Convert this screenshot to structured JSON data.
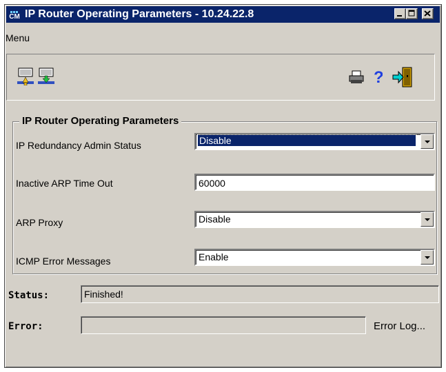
{
  "window": {
    "title": "IP Router Operating Parameters - 10.24.22.8",
    "logo_text": "CM"
  },
  "menu": {
    "label": "Menu"
  },
  "toolbar": {
    "buttons": [
      "upload-icon",
      "download-icon",
      "print-icon",
      "help-icon",
      "exit-icon"
    ]
  },
  "group": {
    "title": "IP Router Operating Parameters",
    "fields": [
      {
        "label": "IP Redundancy Admin Status",
        "value": "Disable"
      },
      {
        "label": "Inactive ARP Time Out",
        "value": "60000"
      },
      {
        "label": "ARP Proxy",
        "value": "Disable"
      },
      {
        "label": "ICMP Error Messages",
        "value": "Enable"
      }
    ]
  },
  "status": {
    "label": "Status:",
    "value": "Finished!"
  },
  "error": {
    "label": "Error:",
    "value": "",
    "log_link": "Error Log..."
  },
  "colors": {
    "titlebar": "#0a246a",
    "face": "#d4d0c8"
  }
}
